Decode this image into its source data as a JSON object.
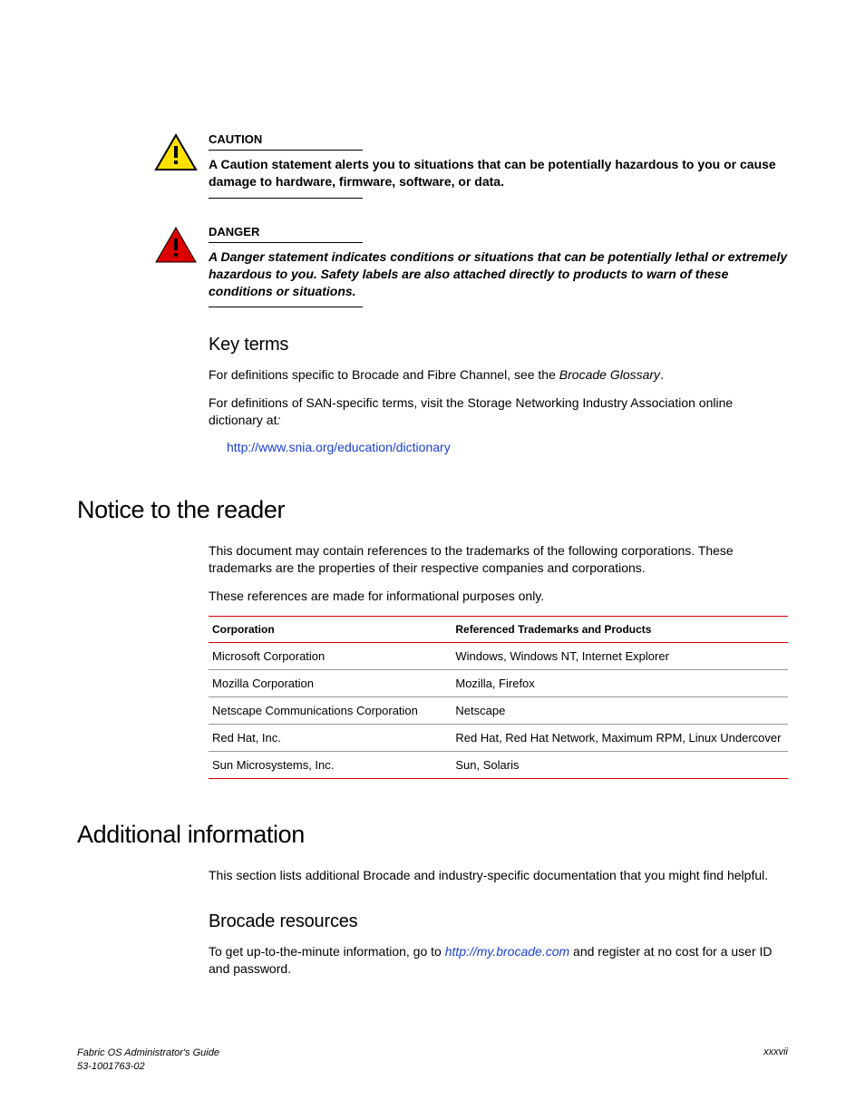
{
  "alerts": {
    "caution": {
      "label": "CAUTION",
      "text": "A Caution statement alerts you to situations that can be potentially hazardous to you or cause damage to hardware, firmware, software, or data."
    },
    "danger": {
      "label": "DANGER",
      "text": "A Danger statement indicates conditions or situations that can be potentially lethal or extremely hazardous to you. Safety labels are also attached directly to products to warn of these conditions or situations."
    }
  },
  "keyterms": {
    "heading": "Key terms",
    "p1_a": "For definitions specific to Brocade and Fibre Channel, see the ",
    "p1_b": "Brocade Glossary",
    "p1_c": ".",
    "p2": "For definitions of SAN-specific terms, visit the Storage Networking Industry Association online dictionary at",
    "link": "http://www.snia.org/education/dictionary"
  },
  "notice": {
    "heading": "Notice to the reader",
    "p1": "This document may contain references to the trademarks of the following corporations. These trademarks are the properties of their respective companies and corporations.",
    "p2": "These references are made for informational purposes only.",
    "columns": [
      "Corporation",
      "Referenced Trademarks and Products"
    ],
    "rows": [
      [
        "Microsoft Corporation",
        "Windows, Windows NT, Internet Explorer"
      ],
      [
        "Mozilla Corporation",
        "Mozilla, Firefox"
      ],
      [
        "Netscape Communications Corporation",
        "Netscape"
      ],
      [
        "Red Hat, Inc.",
        "Red Hat, Red Hat Network, Maximum RPM, Linux Undercover"
      ],
      [
        "Sun Microsystems, Inc.",
        "Sun, Solaris"
      ]
    ]
  },
  "additional": {
    "heading": "Additional information",
    "p1": "This section lists additional Brocade and industry-specific documentation that you might find helpful.",
    "sub": "Brocade resources",
    "p2_a": "To get up-to-the-minute information, go to ",
    "p2_link": "http://my.brocade.com",
    "p2_b": " and register at no cost for a user ID and password."
  },
  "footer": {
    "title": "Fabric OS Administrator's Guide",
    "doc": "53-1001763-02",
    "page": "xxxvii"
  }
}
